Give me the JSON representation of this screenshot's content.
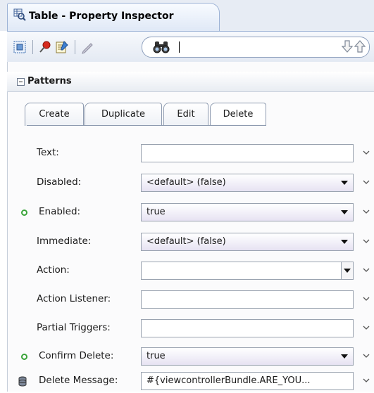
{
  "window": {
    "title": "Table - Property Inspector"
  },
  "toolbar": {
    "icons": [
      "select-region-icon",
      "pin-icon",
      "edit-form-icon",
      "pencil-icon"
    ],
    "search": {
      "icon": "binoculars-icon",
      "value": ""
    },
    "nav_icons": [
      "arrow-down-icon",
      "arrow-up-icon"
    ]
  },
  "section": {
    "title": "Patterns",
    "expanded": true
  },
  "tabs": [
    {
      "label": "Create",
      "active": false
    },
    {
      "label": "Duplicate",
      "active": false
    },
    {
      "label": "Edit",
      "active": false
    },
    {
      "label": "Delete",
      "active": true
    }
  ],
  "properties": [
    {
      "label": "Text:",
      "value": "",
      "type": "text",
      "marker": "none"
    },
    {
      "label": "Disabled:",
      "value": "<default> (false)",
      "type": "select",
      "marker": "none"
    },
    {
      "label": "Enabled:",
      "value": "true",
      "type": "select",
      "marker": "set"
    },
    {
      "label": "Immediate:",
      "value": "<default> (false)",
      "type": "select",
      "marker": "none"
    },
    {
      "label": "Action:",
      "value": "",
      "type": "combo",
      "marker": "none"
    },
    {
      "label": "Action Listener:",
      "value": "",
      "type": "text",
      "marker": "none"
    },
    {
      "label": "Partial Triggers:",
      "value": "",
      "type": "text",
      "marker": "none"
    },
    {
      "label": "Confirm Delete:",
      "value": "true",
      "type": "select",
      "marker": "set"
    },
    {
      "label": "Delete Message:",
      "value": "#{viewcontrollerBundle.ARE_YOU...",
      "type": "text",
      "marker": "bound"
    }
  ],
  "colors": {
    "set_marker": "#3aa43a",
    "select_tint": "#e6e2f2",
    "tab_strip": "#e7ecf4"
  }
}
